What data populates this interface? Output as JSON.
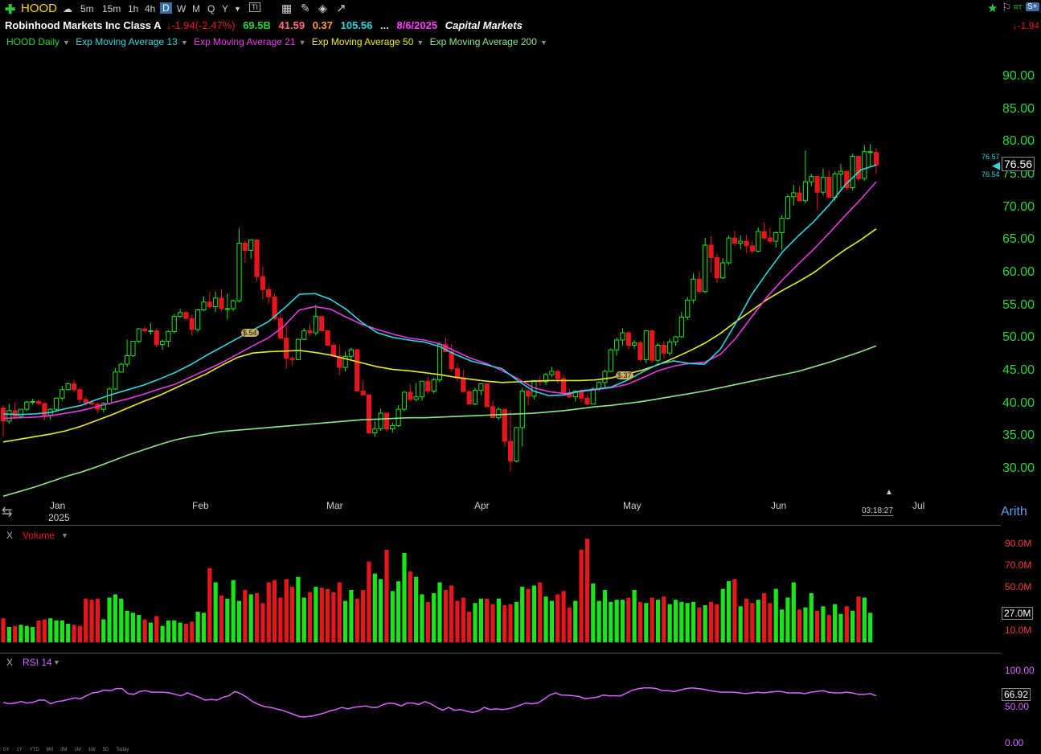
{
  "toolbar": {
    "ticker": "HOOD",
    "intervals": [
      "5m",
      "15m",
      "1h",
      "4h",
      "D",
      "W",
      "M",
      "Q",
      "Y"
    ],
    "active_interval": "D"
  },
  "header": {
    "company": "Robinhood Markets Inc Class A",
    "change": "-1.94",
    "change_pct": "(-2.47%)",
    "volume": "69.5B",
    "pe": "41.59",
    "eps": "0.37",
    "field4": "105.56",
    "ellipsis": "...",
    "earnings_date": "8/6/2025",
    "sector": "Capital Markets",
    "right_change": "-1.94",
    "rt_label": "RT"
  },
  "legend": {
    "main": "HOOD Daily",
    "ema13": "Exp Moving Average 13",
    "ema21": "Exp Moving Average 21",
    "ema50": "Exp Moving Average 50",
    "ema200": "Exp Moving Average 200"
  },
  "price_axis": {
    "ticks": [
      "90.00",
      "85.00",
      "80.00",
      "75.00",
      "70.00",
      "65.00",
      "60.00",
      "55.00",
      "50.00",
      "45.00",
      "40.00",
      "35.00",
      "30.00"
    ],
    "last_price": "76.56",
    "ema13_value": "76.57",
    "ema21_value": "76.54"
  },
  "time_axis": {
    "labels": [
      "Jan",
      "Feb",
      "Mar",
      "Apr",
      "May",
      "Jun",
      "Jul"
    ],
    "year": "2025",
    "clock": "03:18:27",
    "scale": "Arith"
  },
  "annotations": {
    "div1": "$.54",
    "div2": "$.37"
  },
  "volume_panel": {
    "title": "Volume",
    "close_mark": "X",
    "ticks": [
      "90.0M",
      "70.0M",
      "50.0M",
      "27.0M",
      "10.0M"
    ],
    "last": "27.0M"
  },
  "rsi_panel": {
    "title": "RSI 14",
    "close_mark": "X",
    "ticks": [
      "100.00",
      "50.00",
      "0.00"
    ],
    "last": "66.92"
  },
  "footer": {
    "ranges": [
      "5Y",
      "1Y",
      "YTD",
      "6M",
      "3M",
      "1M",
      "1W",
      "5D",
      "Today"
    ]
  },
  "colors": {
    "up": "#19e619",
    "down": "#e8161c",
    "ema13": "#2fd6de",
    "ema21": "#e33be3",
    "ema50": "#ecec1e",
    "ema200": "#8ee68a",
    "rsi": "#d764ff"
  },
  "chart_data": {
    "type": "candlestick",
    "title": "HOOD Daily",
    "ylim": [
      28,
      93
    ],
    "x_labels": [
      "Jan",
      "Feb",
      "Mar",
      "Apr",
      "May",
      "Jun",
      "Jul"
    ],
    "ohlc": [
      [
        39.4,
        39.8,
        35.0,
        37.4
      ],
      [
        37.4,
        40.0,
        37.0,
        39.0
      ],
      [
        39.0,
        40.3,
        37.8,
        38.1
      ],
      [
        38.1,
        39.2,
        37.8,
        39.2
      ],
      [
        39.2,
        40.5,
        38.9,
        40.3
      ],
      [
        40.3,
        40.8,
        39.9,
        40.4
      ],
      [
        40.4,
        40.7,
        39.8,
        40.1
      ],
      [
        40.1,
        40.1,
        37.5,
        38.3
      ],
      [
        38.3,
        39.4,
        37.6,
        39.2
      ],
      [
        39.2,
        41.0,
        38.9,
        40.9
      ],
      [
        40.9,
        42.8,
        40.5,
        42.2
      ],
      [
        42.2,
        43.3,
        42.1,
        43.1
      ],
      [
        43.1,
        43.7,
        41.8,
        42.2
      ],
      [
        42.2,
        42.5,
        40.2,
        40.7
      ],
      [
        40.7,
        41.1,
        39.7,
        40.2
      ],
      [
        40.2,
        40.6,
        39.8,
        40.0
      ],
      [
        40.0,
        40.2,
        38.6,
        39.2
      ],
      [
        39.2,
        40.3,
        38.7,
        40.1
      ],
      [
        40.1,
        42.6,
        39.9,
        42.3
      ],
      [
        42.3,
        45.5,
        42.1,
        44.9
      ],
      [
        44.9,
        46.3,
        44.8,
        46.1
      ],
      [
        46.1,
        49.9,
        45.7,
        47.4
      ],
      [
        47.4,
        49.7,
        47.2,
        49.6
      ],
      [
        49.6,
        51.6,
        49.3,
        51.5
      ],
      [
        51.5,
        51.9,
        51.0,
        51.2
      ],
      [
        51.2,
        52.3,
        50.6,
        51.2
      ],
      [
        51.2,
        51.6,
        48.7,
        49.1
      ],
      [
        49.1,
        49.9,
        48.3,
        49.6
      ],
      [
        49.6,
        51.3,
        48.7,
        51.1
      ],
      [
        51.1,
        53.8,
        50.8,
        53.4
      ],
      [
        53.4,
        54.6,
        53.2,
        54.0
      ],
      [
        54.0,
        54.2,
        52.9,
        53.1
      ],
      [
        53.1,
        53.7,
        50.4,
        51.4
      ],
      [
        51.4,
        54.6,
        51.0,
        54.4
      ],
      [
        54.4,
        56.4,
        54.2,
        55.6
      ],
      [
        55.6,
        57.2,
        54.6,
        54.9
      ],
      [
        54.9,
        57.2,
        54.1,
        56.2
      ],
      [
        56.2,
        57.6,
        54.2,
        54.6
      ],
      [
        54.6,
        56.9,
        52.9,
        54.6
      ],
      [
        54.6,
        56.0,
        54.2,
        55.8
      ],
      [
        55.8,
        66.9,
        55.5,
        64.6
      ],
      [
        64.6,
        65.0,
        61.6,
        63.5
      ],
      [
        63.5,
        65.0,
        62.2,
        65.1
      ],
      [
        65.1,
        65.1,
        58.8,
        59.5
      ],
      [
        59.5,
        61.0,
        56.0,
        57.5
      ],
      [
        57.5,
        58.1,
        55.3,
        56.4
      ],
      [
        56.4,
        56.9,
        52.9,
        53.1
      ],
      [
        53.1,
        53.8,
        49.8,
        50.1
      ],
      [
        50.1,
        52.0,
        45.4,
        47.0
      ],
      [
        47.0,
        47.3,
        45.9,
        46.8
      ],
      [
        46.8,
        50.0,
        46.7,
        49.9
      ],
      [
        49.9,
        51.6,
        49.8,
        51.2
      ],
      [
        51.2,
        52.3,
        50.4,
        50.9
      ],
      [
        50.9,
        55.2,
        50.5,
        53.4
      ],
      [
        53.4,
        53.5,
        51.5,
        51.2
      ],
      [
        51.2,
        51.3,
        49.6,
        49.0
      ],
      [
        49.0,
        49.4,
        47.6,
        47.3
      ],
      [
        47.3,
        49.0,
        44.4,
        45.6
      ],
      [
        45.6,
        48.0,
        45.0,
        47.3
      ],
      [
        47.3,
        48.6,
        46.8,
        48.3
      ],
      [
        48.3,
        48.5,
        43.3,
        42.0
      ],
      [
        42.0,
        43.6,
        41.8,
        41.4
      ],
      [
        41.4,
        41.4,
        35.6,
        35.6
      ],
      [
        35.6,
        37.4,
        35.0,
        36.2
      ],
      [
        36.2,
        39.3,
        35.9,
        38.6
      ],
      [
        38.6,
        38.7,
        35.8,
        36.2
      ],
      [
        36.2,
        37.2,
        35.6,
        36.7
      ],
      [
        36.7,
        39.8,
        36.5,
        39.2
      ],
      [
        39.2,
        42.0,
        38.9,
        41.8
      ],
      [
        41.8,
        43.0,
        40.4,
        40.7
      ],
      [
        40.7,
        43.2,
        40.4,
        41.1
      ],
      [
        41.1,
        43.5,
        40.5,
        43.5
      ],
      [
        43.5,
        44.2,
        41.5,
        42.0
      ],
      [
        42.0,
        44.0,
        41.6,
        43.7
      ],
      [
        43.7,
        49.5,
        43.3,
        49.1
      ],
      [
        49.1,
        50.2,
        48.3,
        48.0
      ],
      [
        48.0,
        49.2,
        45.0,
        45.4
      ],
      [
        45.4,
        46.2,
        43.4,
        44.0
      ],
      [
        44.0,
        45.3,
        42.5,
        41.9
      ],
      [
        41.9,
        42.1,
        40.2,
        40.0
      ],
      [
        40.0,
        42.5,
        39.8,
        42.1
      ],
      [
        42.1,
        43.2,
        41.3,
        43.1
      ],
      [
        43.1,
        43.2,
        39.6,
        39.6
      ],
      [
        39.6,
        40.5,
        37.9,
        37.9
      ],
      [
        37.9,
        39.5,
        37.6,
        39.2
      ],
      [
        39.2,
        34.6,
        33.5,
        34.3
      ],
      [
        34.3,
        39.0,
        29.7,
        31.3
      ],
      [
        31.3,
        36.5,
        31.1,
        36.4
      ],
      [
        36.4,
        42.5,
        33.5,
        42.0
      ],
      [
        42.0,
        42.3,
        39.8,
        41.2
      ],
      [
        41.2,
        43.0,
        40.7,
        43.6
      ],
      [
        43.6,
        44.3,
        42.8,
        43.4
      ],
      [
        43.4,
        44.8,
        42.9,
        44.5
      ],
      [
        44.5,
        45.7,
        44.1,
        45.0
      ],
      [
        45.0,
        45.3,
        43.1,
        43.9
      ],
      [
        43.9,
        44.5,
        41.6,
        41.6
      ],
      [
        41.6,
        42.3,
        40.9,
        41.1
      ],
      [
        41.1,
        42.1,
        40.4,
        42.0
      ],
      [
        42.0,
        42.3,
        40.2,
        40.9
      ],
      [
        40.9,
        41.4,
        39.8,
        40.0
      ],
      [
        40.0,
        42.6,
        40.5,
        42.3
      ],
      [
        42.3,
        43.5,
        42.0,
        43.3
      ],
      [
        43.3,
        45.3,
        42.5,
        45.0
      ],
      [
        45.0,
        48.5,
        44.9,
        48.3
      ],
      [
        48.3,
        50.2,
        47.4,
        49.8
      ],
      [
        49.8,
        51.6,
        48.9,
        50.9
      ],
      [
        50.9,
        51.2,
        48.3,
        49.0
      ],
      [
        49.0,
        49.8,
        48.4,
        49.4
      ],
      [
        49.4,
        49.7,
        46.5,
        46.8
      ],
      [
        46.8,
        51.3,
        46.2,
        51.2
      ],
      [
        51.2,
        51.4,
        46.3,
        46.7
      ],
      [
        46.7,
        49.3,
        46.4,
        49.0
      ],
      [
        49.0,
        49.7,
        47.0,
        47.8
      ],
      [
        47.8,
        50.0,
        47.4,
        49.5
      ],
      [
        49.5,
        50.4,
        48.9,
        50.3
      ],
      [
        50.3,
        54.1,
        50.1,
        53.3
      ],
      [
        53.3,
        56.4,
        52.9,
        55.9
      ],
      [
        55.9,
        60.0,
        55.4,
        59.1
      ],
      [
        59.1,
        60.3,
        57.0,
        57.2
      ],
      [
        57.2,
        65.4,
        57.0,
        64.3
      ],
      [
        64.3,
        65.7,
        60.1,
        62.4
      ],
      [
        62.4,
        63.0,
        58.5,
        59.3
      ],
      [
        59.3,
        62.3,
        59.1,
        61.6
      ],
      [
        61.6,
        65.8,
        61.3,
        65.4
      ],
      [
        65.4,
        66.5,
        64.2,
        64.6
      ],
      [
        64.6,
        65.8,
        63.7,
        64.9
      ],
      [
        64.9,
        65.9,
        63.1,
        64.2
      ],
      [
        64.2,
        65.0,
        63.0,
        63.4
      ],
      [
        63.4,
        67.0,
        63.2,
        66.4
      ],
      [
        66.4,
        67.8,
        65.1,
        65.4
      ],
      [
        65.4,
        67.0,
        64.6,
        64.9
      ],
      [
        64.9,
        66.4,
        63.9,
        66.2
      ],
      [
        66.2,
        68.9,
        63.6,
        68.4
      ],
      [
        68.4,
        72.1,
        68.2,
        71.7
      ],
      [
        71.7,
        73.5,
        70.4,
        72.3
      ],
      [
        72.3,
        73.4,
        71.6,
        71.1
      ],
      [
        71.1,
        78.8,
        70.7,
        74.0
      ],
      [
        74.0,
        75.2,
        73.3,
        74.8
      ],
      [
        74.8,
        74.6,
        69.6,
        72.4
      ],
      [
        72.4,
        76.0,
        71.9,
        74.7
      ],
      [
        74.7,
        75.8,
        71.8,
        71.6
      ],
      [
        71.6,
        75.6,
        71.1,
        75.2
      ],
      [
        75.2,
        76.7,
        72.9,
        75.6
      ],
      [
        75.6,
        75.4,
        72.7,
        73.1
      ],
      [
        73.1,
        78.3,
        72.7,
        77.9
      ],
      [
        77.9,
        77.8,
        74.0,
        74.5
      ],
      [
        74.5,
        79.6,
        74.1,
        78.6
      ],
      [
        78.6,
        79.8,
        76.2,
        78.6
      ],
      [
        78.5,
        79.2,
        75.2,
        76.56
      ]
    ],
    "ema13": [
      38.5,
      38.4,
      38.5,
      38.7,
      39.3,
      39.8,
      40.7,
      41.5,
      42.2,
      42.9,
      43.8,
      44.8,
      46.0,
      47.4,
      48.7,
      50.0,
      51.3,
      52.6,
      54.6,
      56.8,
      56.9,
      56.0,
      54.5,
      52.5,
      50.9,
      50.2,
      49.8,
      49.5,
      48.8,
      47.6,
      46.6,
      46.0,
      45.4,
      43.6,
      42.0,
      41.3,
      41.4,
      42.0,
      42.3,
      42.6,
      43.6,
      44.9,
      46.1,
      46.6,
      46.2,
      46.1,
      48.4,
      52.4,
      56.7,
      60.1,
      63.3,
      65.7,
      67.9,
      70.5,
      73.5,
      75.8,
      76.57
    ],
    "ema21": [
      37.8,
      37.9,
      38.0,
      38.2,
      38.6,
      39.0,
      39.6,
      40.2,
      40.8,
      41.5,
      42.3,
      43.0,
      44.1,
      45.2,
      46.3,
      47.6,
      48.9,
      50.1,
      51.9,
      54.4,
      54.9,
      54.5,
      53.3,
      52.2,
      51.4,
      50.7,
      50.1,
      49.8,
      49.2,
      48.1,
      47.0,
      46.2,
      45.1,
      43.9,
      42.5,
      41.9,
      41.6,
      41.9,
      42.2,
      42.5,
      43.0,
      44.0,
      45.1,
      45.8,
      46.2,
      46.4,
      47.6,
      50.1,
      53.3,
      56.4,
      59.0,
      61.4,
      63.7,
      66.2,
      68.8,
      71.3,
      74.0
    ],
    "ema50": [
      34.2,
      34.6,
      35.0,
      35.4,
      35.9,
      36.6,
      37.5,
      38.4,
      39.4,
      40.4,
      41.3,
      42.4,
      43.5,
      44.6,
      45.9,
      47.1,
      47.8,
      48.0,
      48.1,
      48.2,
      47.9,
      47.5,
      46.9,
      46.3,
      45.7,
      45.3,
      45.1,
      44.8,
      44.5,
      44.1,
      43.8,
      43.5,
      43.3,
      43.4,
      43.5,
      43.6,
      43.6,
      43.6,
      43.7,
      44.0,
      44.6,
      45.2,
      46.0,
      47.0,
      48.1,
      49.3,
      50.8,
      52.6,
      54.3,
      56.0,
      57.4,
      58.7,
      60.1,
      61.9,
      63.6,
      65.1,
      66.8
    ],
    "ema200": [
      25.9,
      26.6,
      27.3,
      28.1,
      28.9,
      29.6,
      30.4,
      31.3,
      32.2,
      33.0,
      33.8,
      34.5,
      35.0,
      35.4,
      35.8,
      36.0,
      36.2,
      36.4,
      36.6,
      36.8,
      37.0,
      37.2,
      37.4,
      37.6,
      37.7,
      37.8,
      37.9,
      37.9,
      38.0,
      38.1,
      38.2,
      38.3,
      38.4,
      38.5,
      38.6,
      38.8,
      39.0,
      39.3,
      39.6,
      39.8,
      40.1,
      40.4,
      40.8,
      41.2,
      41.6,
      42.0,
      42.5,
      43.0,
      43.5,
      44.0,
      44.5,
      45.0,
      45.7,
      46.4,
      47.2,
      48.0,
      48.9
    ],
    "volume_millions": [
      22,
      14,
      15,
      16,
      15,
      14,
      20,
      21,
      22,
      20,
      20,
      17,
      16,
      15,
      40,
      39,
      40,
      21,
      41,
      44,
      40,
      29,
      27,
      25,
      21,
      18,
      24,
      15,
      20,
      20,
      18,
      17,
      19,
      28,
      27,
      68,
      55,
      43,
      40,
      57,
      38,
      48,
      44,
      45,
      36,
      55,
      57,
      41,
      58,
      51,
      60,
      41,
      46,
      51,
      50,
      49,
      46,
      55,
      38,
      48,
      40,
      48,
      74,
      63,
      58,
      85,
      47,
      56,
      82,
      65,
      60,
      44,
      37,
      45,
      55,
      48,
      52,
      38,
      41,
      28,
      36,
      40,
      40,
      35,
      40,
      34,
      35,
      37,
      51,
      49,
      52,
      55,
      42,
      38,
      44,
      47,
      32,
      38,
      85,
      95,
      54,
      38,
      48,
      37,
      39,
      39,
      41,
      48,
      37,
      36,
      41,
      39,
      42,
      35,
      39,
      37,
      36,
      37,
      32,
      34,
      37,
      35,
      49,
      56,
      58,
      33,
      40,
      36,
      39,
      45,
      36,
      49,
      30,
      41,
      55,
      30,
      32,
      45,
      29,
      33,
      25,
      35,
      26,
      33,
      29,
      42,
      41,
      27
    ],
    "rsi": [
      57,
      55,
      56,
      58,
      56,
      57,
      60,
      60,
      55,
      58,
      59,
      61,
      63,
      62,
      66,
      70,
      71,
      74,
      73,
      76,
      76,
      69,
      68,
      72,
      73,
      71,
      71,
      71,
      70,
      68,
      66,
      70,
      67,
      64,
      60,
      61,
      60,
      64,
      66,
      72,
      69,
      64,
      58,
      54,
      51,
      50,
      48,
      46,
      43,
      40,
      37,
      37,
      38,
      40,
      42,
      45,
      47,
      50,
      48,
      50,
      51,
      52,
      50,
      50,
      54,
      56,
      55,
      52,
      56,
      56,
      54,
      58,
      55,
      50,
      46,
      50,
      46,
      47,
      45,
      43,
      45,
      50,
      47,
      48,
      47,
      48,
      50,
      53,
      56,
      55,
      56,
      61,
      67,
      70,
      67,
      67,
      66,
      65,
      62,
      63,
      64,
      67,
      66,
      66,
      66,
      70,
      74,
      76,
      77,
      77,
      76,
      73,
      73,
      72,
      74,
      76,
      77,
      76,
      75,
      73,
      72,
      71,
      71,
      71,
      70,
      69,
      70,
      71,
      70,
      71,
      72,
      72,
      70,
      70,
      70,
      69,
      71,
      72,
      73,
      71,
      70,
      70,
      71,
      70,
      68,
      68,
      69,
      66
    ]
  }
}
